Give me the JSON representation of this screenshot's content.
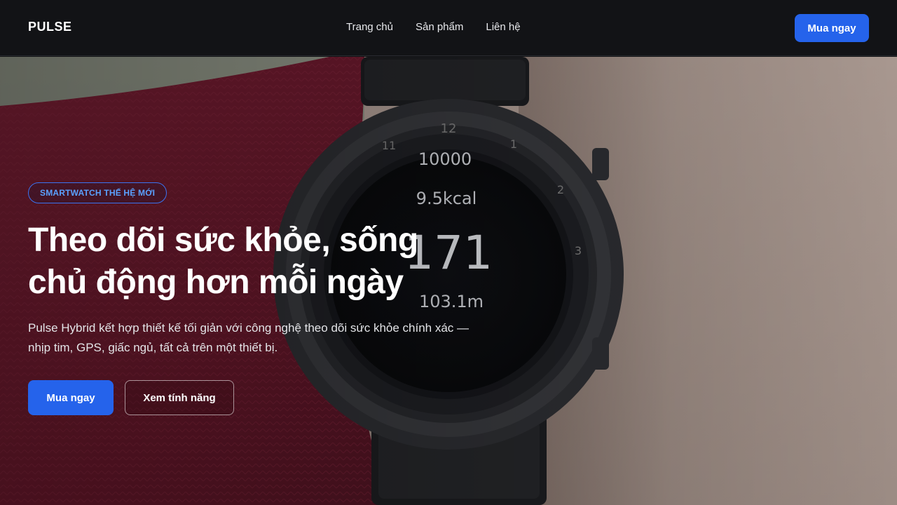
{
  "nav": {
    "logo": "PULSE",
    "links": [
      {
        "label": "Trang chủ"
      },
      {
        "label": "Sản phẩm"
      },
      {
        "label": "Liên hệ"
      }
    ],
    "cta_label": "Mua ngay"
  },
  "hero": {
    "badge": "SMARTWATCH THẾ HỆ MỚI",
    "headline_line1": "Theo dõi sức khỏe, sống",
    "headline_line2": "chủ động hơn mỗi ngày",
    "subtext": "Pulse Hybrid kết hợp thiết kế tối giản với công nghệ theo dõi sức khỏe chính xác — nhịp tim, GPS, giấc ngủ, tất cả trên một thiết bị.",
    "primary_button": "Mua ngay",
    "secondary_button": "Xem tính năng",
    "watch_face": {
      "steps": "10000",
      "calories": "9.5kcal",
      "heart_rate": "171",
      "distance": "103.1m",
      "bezel_numbers": [
        "12",
        "1",
        "2",
        "3",
        "11"
      ]
    }
  },
  "colors": {
    "accent": "#2563eb",
    "badge_text": "#5aa1ff",
    "nav_bg": "#121316"
  }
}
